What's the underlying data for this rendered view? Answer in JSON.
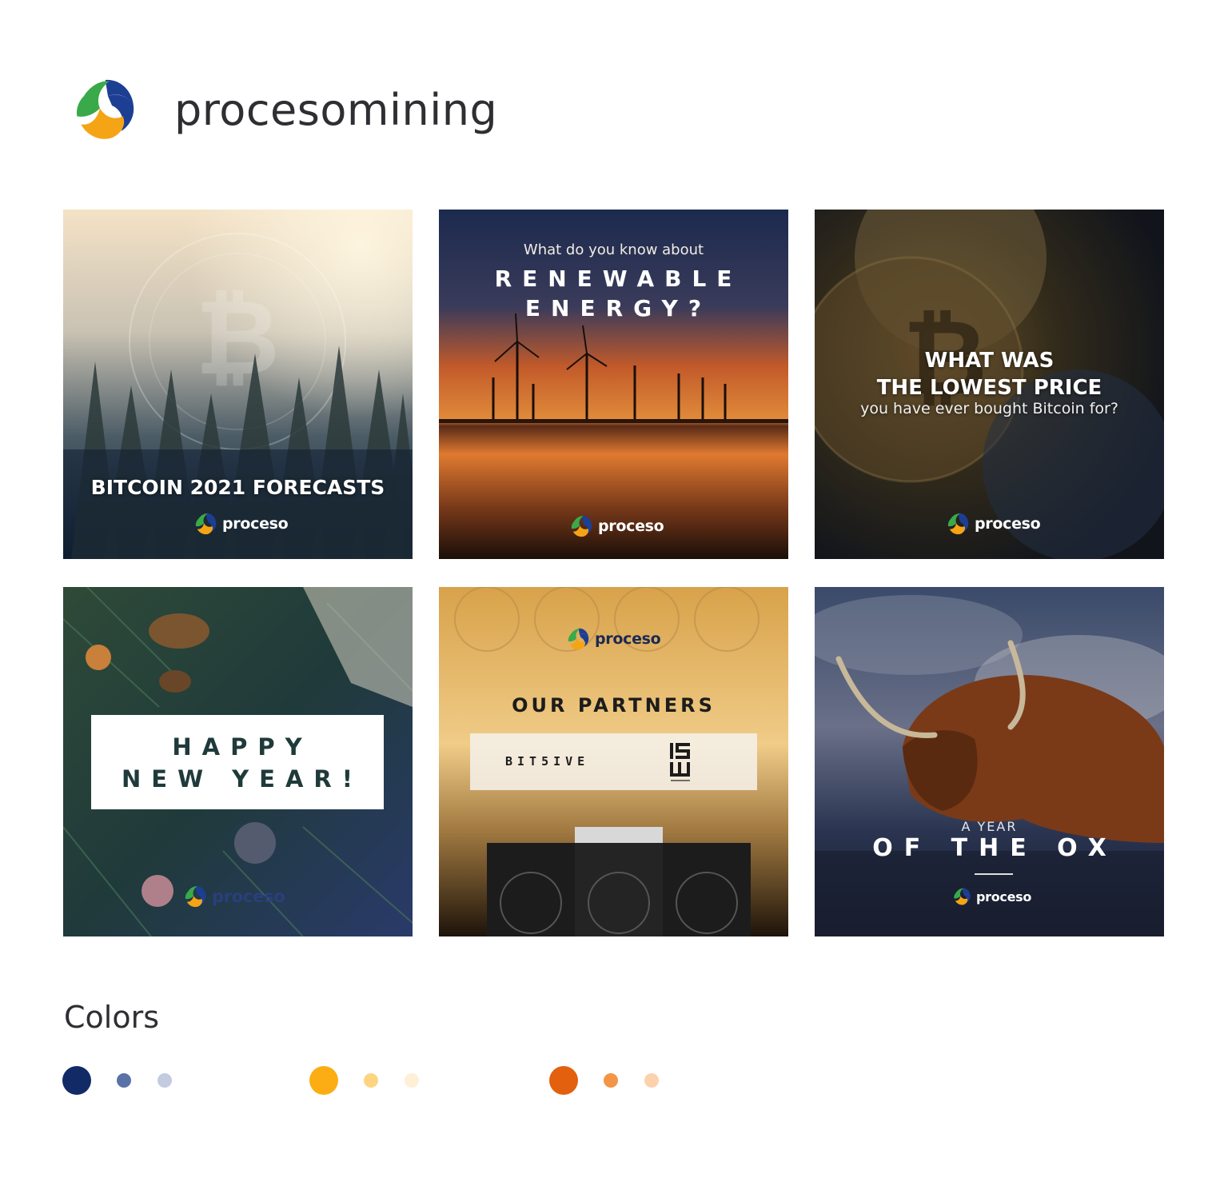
{
  "header": {
    "brand_name": "procesomining"
  },
  "tiles": [
    {
      "headline": "BITCOIN 2021 FORECASTS",
      "brand": "proceso"
    },
    {
      "pre": "What do you know about",
      "line1": "RENEWABLE",
      "line2": "ENERGY?",
      "brand": "proceso"
    },
    {
      "line1": "WHAT WAS",
      "line2": "THE LOWEST PRICE",
      "line3": "you have ever bought Bitcoin for?",
      "brand": "proceso"
    },
    {
      "line1": "HAPPY",
      "line2": "NEW YEAR!",
      "brand": "proceso"
    },
    {
      "brand": "proceso",
      "title": "OUR PARTNERS",
      "partner1": "BIT5IVE",
      "partner2": "ISW HOLDINGS"
    },
    {
      "small": "A YEAR",
      "big": "OF THE OX",
      "brand": "proceso"
    }
  ],
  "colors": {
    "title": "Colors",
    "swatches": [
      {
        "group": "blue",
        "hex": [
          "#122a66",
          "#5a72a8",
          "#c3cbe0"
        ]
      },
      {
        "group": "yellow",
        "hex": [
          "#fcad14",
          "#fdd581",
          "#fdf0d6"
        ]
      },
      {
        "group": "orange",
        "hex": [
          "#e2600e",
          "#f49447",
          "#fbd2ab"
        ]
      }
    ]
  }
}
